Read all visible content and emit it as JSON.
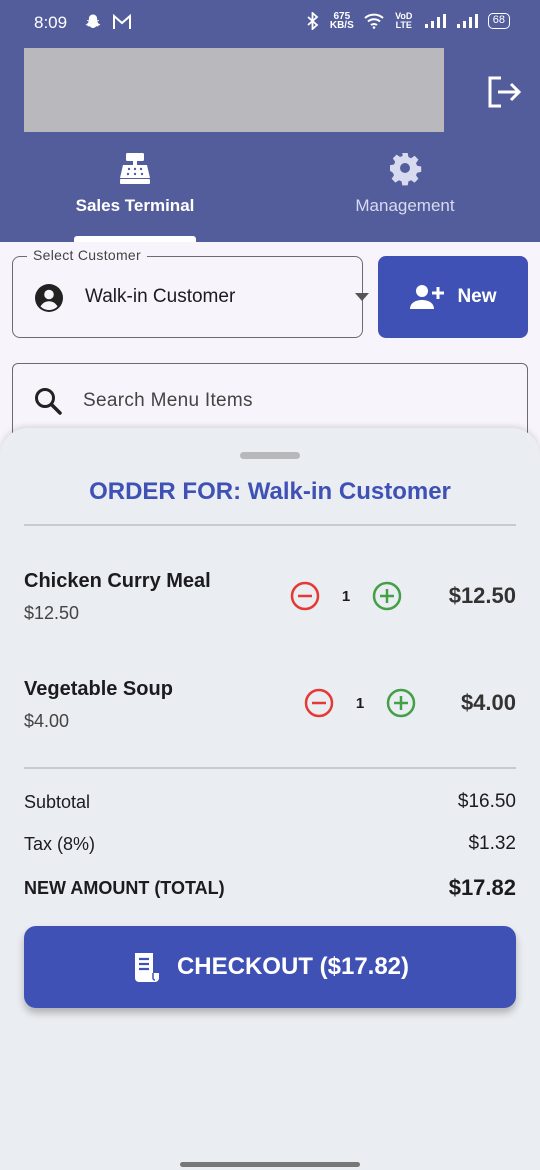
{
  "status_bar": {
    "time": "8:09",
    "speed_value": "675",
    "speed_unit": "KB/S",
    "network": "VoD LTE",
    "battery": "68"
  },
  "icons": {
    "logout": "logout-icon",
    "sales_tab": "cash-register-icon",
    "management_tab": "gear-icon",
    "customer": "account-circle-icon",
    "new_customer": "person-add-icon",
    "search": "search-icon",
    "decrease": "minus-circle-icon",
    "increase": "plus-circle-icon",
    "checkout": "receipt-icon"
  },
  "tabs": [
    {
      "label": "Sales Terminal",
      "active": true
    },
    {
      "label": "Management",
      "active": false
    }
  ],
  "customer_select": {
    "legend": "Select Customer",
    "value": "Walk-in Customer"
  },
  "new_button": {
    "label": "New"
  },
  "search": {
    "placeholder": "Search Menu Items",
    "value": ""
  },
  "order": {
    "title": "ORDER FOR: Walk-in Customer",
    "items": [
      {
        "name": "Chicken Curry Meal",
        "unit_price": "$12.50",
        "quantity": "1",
        "line_total": "$12.50"
      },
      {
        "name": "Vegetable Soup",
        "unit_price": "$4.00",
        "quantity": "1",
        "line_total": "$4.00"
      }
    ],
    "subtotal_label": "Subtotal",
    "subtotal_value": "$16.50",
    "tax_label": "Tax (8%)",
    "tax_value": "$1.32",
    "total_label": "NEW AMOUNT (TOTAL)",
    "total_value": "$17.82"
  },
  "checkout_button": {
    "label": "CHECKOUT ($17.82)"
  },
  "colors": {
    "header": "#545d9c",
    "primary": "#3f51b5",
    "sheet": "#eaedf1",
    "decrease": "#e53935",
    "increase": "#43a047"
  }
}
